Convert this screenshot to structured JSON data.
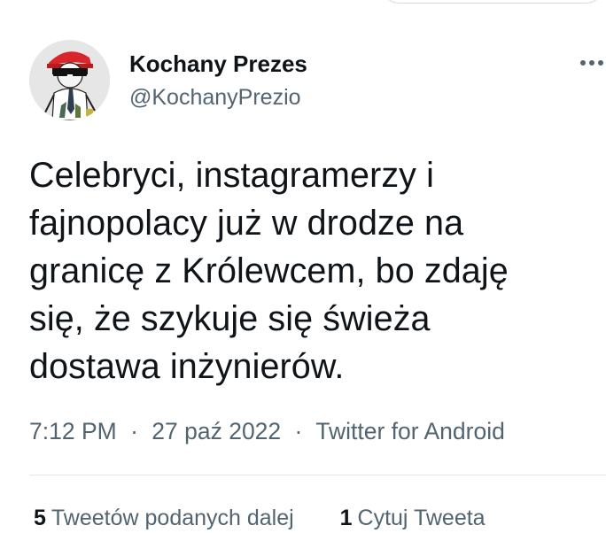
{
  "author": {
    "display_name": "Kochany Prezes",
    "handle": "@KochanyPrezio"
  },
  "tweet": {
    "text": "Celebryci, instagramerzy i\nfajnopolacy już w drodze na\ngranicę z Królewcem, bo zdaję\nsię, że szykuje się świeża\ndostawa inżynierów."
  },
  "meta": {
    "time": "7:12 PM",
    "separator": "·",
    "date": "27 paź 2022",
    "source": "Twitter for Android"
  },
  "stats": {
    "retweets_count": "5",
    "retweets_label": "Tweetów podanych dalej",
    "quotes_count": "1",
    "quotes_label": "Cytuj Tweeta"
  },
  "icons": {
    "more": "more-horizontal-icon",
    "avatar": "avatar-image"
  },
  "colors": {
    "text_primary": "#0f1419",
    "text_secondary": "#536471",
    "divider": "#e1e8ed"
  }
}
